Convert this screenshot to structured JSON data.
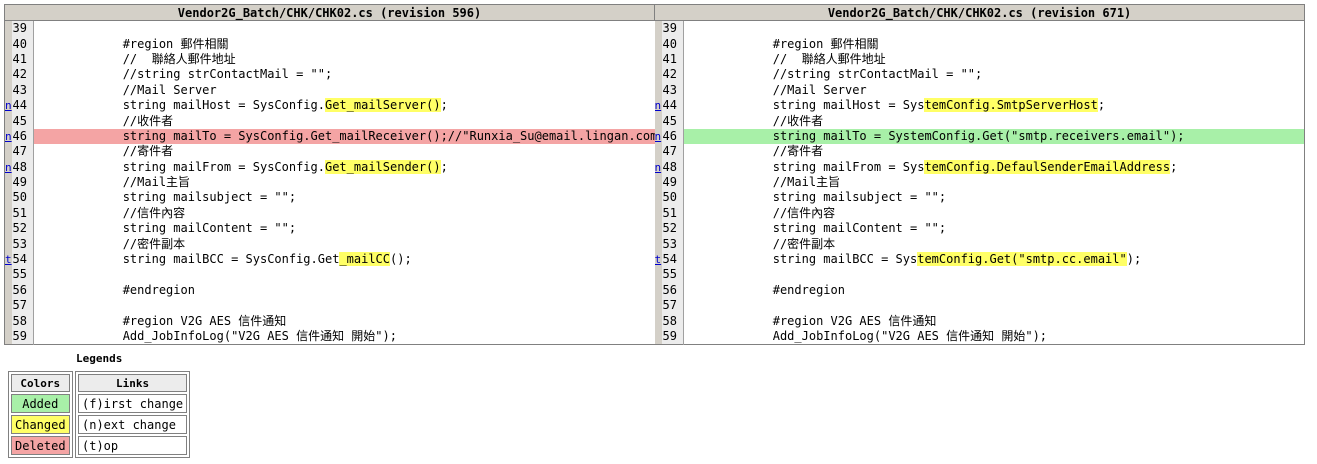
{
  "header": {
    "left_title": "Vendor2G_Batch/CHK/CHK02.cs  (revision 596)",
    "right_title": "Vendor2G_Batch/CHK/CHK02.cs  (revision 671)"
  },
  "rows": [
    {
      "num": "39",
      "link": "",
      "status": "",
      "left": "",
      "right": ""
    },
    {
      "num": "40",
      "link": "",
      "status": "",
      "left": "            #region 郵件相關",
      "right": "            #region 郵件相關"
    },
    {
      "num": "41",
      "link": "",
      "status": "",
      "left": "            //  聯絡人郵件地址",
      "right": "            //  聯絡人郵件地址"
    },
    {
      "num": "42",
      "link": "",
      "status": "",
      "left": "            //string strContactMail = \"\";",
      "right": "            //string strContactMail = \"\";"
    },
    {
      "num": "43",
      "link": "",
      "status": "",
      "left": "            //Mail Server",
      "right": "            //Mail Server"
    },
    {
      "num": "44",
      "link": "n",
      "status": "changed",
      "left_pre": "            string mailHost = SysConfig.",
      "left_chg": "Get_mailServer()",
      "left_post": ";",
      "right_pre": "            string mailHost = Sys",
      "right_chg": "temConfig.SmtpServerHost",
      "right_post": ";"
    },
    {
      "num": "45",
      "link": "",
      "status": "",
      "left": "            //收件者",
      "right": "            //收件者"
    },
    {
      "num": "46",
      "link": "n",
      "status": "replaced",
      "left": "            string mailTo = SysConfig.Get_mailReceiver();//\"Runxia_Su@email.lingan.com.cn\";",
      "right": "            string mailTo = SystemConfig.Get(\"smtp.receivers.email\");"
    },
    {
      "num": "47",
      "link": "",
      "status": "",
      "left": "            //寄件者",
      "right": "            //寄件者"
    },
    {
      "num": "48",
      "link": "n",
      "status": "changed",
      "left_pre": "            string mailFrom = SysConfig.",
      "left_chg": "Get_mailSender()",
      "left_post": ";",
      "right_pre": "            string mailFrom = Sys",
      "right_chg": "temConfig.DefaulSenderEmailAddress",
      "right_post": ";"
    },
    {
      "num": "49",
      "link": "",
      "status": "",
      "left": "            //Mail主旨",
      "right": "            //Mail主旨"
    },
    {
      "num": "50",
      "link": "",
      "status": "",
      "left": "            string mailsubject = \"\";",
      "right": "            string mailsubject = \"\";"
    },
    {
      "num": "51",
      "link": "",
      "status": "",
      "left": "            //信件內容",
      "right": "            //信件內容"
    },
    {
      "num": "52",
      "link": "",
      "status": "",
      "left": "            string mailContent = \"\";",
      "right": "            string mailContent = \"\";"
    },
    {
      "num": "53",
      "link": "",
      "status": "",
      "left": "            //密件副本",
      "right": "            //密件副本"
    },
    {
      "num": "54",
      "link": "t",
      "status": "changed",
      "left_pre": "            string mailBCC = SysConfig.Get",
      "left_chg": "_mailCC",
      "left_post": "();",
      "right_pre": "            string mailBCC = Sys",
      "right_chg": "temConfig.Get(\"smtp.cc.email\"",
      "right_post": ");"
    },
    {
      "num": "55",
      "link": "",
      "status": "",
      "left": "",
      "right": ""
    },
    {
      "num": "56",
      "link": "",
      "status": "",
      "left": "            #endregion",
      "right": "            #endregion"
    },
    {
      "num": "57",
      "link": "",
      "status": "",
      "left": "",
      "right": ""
    },
    {
      "num": "58",
      "link": "",
      "status": "",
      "left": "            #region V2G AES 信件通知",
      "right": "            #region V2G AES 信件通知"
    },
    {
      "num": "59",
      "link": "",
      "status": "",
      "left": "            Add_JobInfoLog(\"V2G AES 信件通知 開始\");",
      "right": "            Add_JobInfoLog(\"V2G AES 信件通知 開始\");"
    }
  ],
  "legends": {
    "title": "Legends",
    "colors_header": "Colors",
    "added": "Added",
    "changed": "Changed",
    "deleted": "Deleted",
    "links_header": "Links",
    "first": "(f)irst change",
    "next": "(n)ext change",
    "top": "(t)op",
    "colors": {
      "added": "#a8f0a8",
      "changed": "#ffff66",
      "deleted": "#f4a4a4"
    }
  }
}
